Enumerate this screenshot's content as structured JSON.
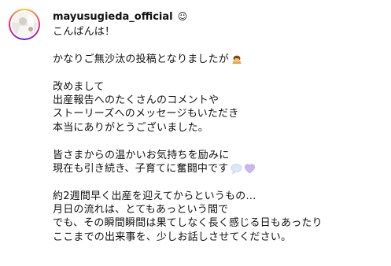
{
  "post": {
    "username": "mayusugieda_official",
    "username_emoji": "☺",
    "caption_lines": [
      "こんばんは！",
      "",
      "かなりご無沙汰の投稿となりましたが",
      "",
      "改めまして",
      "出産報告へのたくさんのコメントや",
      "ストーリーズへのメッセージもいただき",
      "本当にありがとうございました。",
      "",
      "皆さまからの温かいお気持ちを励みに",
      "現在も引き続き、子育てに奮闘中です",
      "",
      "約2週間早く出産を迎えてからというもの…",
      "月日の流れは、とてもあっという間で",
      "でも、その瞬間瞬間は果てしなく長く感じる日もあったり",
      "ここまでの出来事を、少しお話しさせてください。"
    ],
    "emoji_after_line_3": "bowing-person-emoji",
    "emoji_after_line_11": "speech-bubble-and-heart-emoji",
    "colors": {
      "ring": [
        "#f9ce34",
        "#ee2a7b",
        "#6228d7"
      ],
      "text": "#111111",
      "heart": "#c9b8f0",
      "bubble": "#dde6f5"
    }
  }
}
